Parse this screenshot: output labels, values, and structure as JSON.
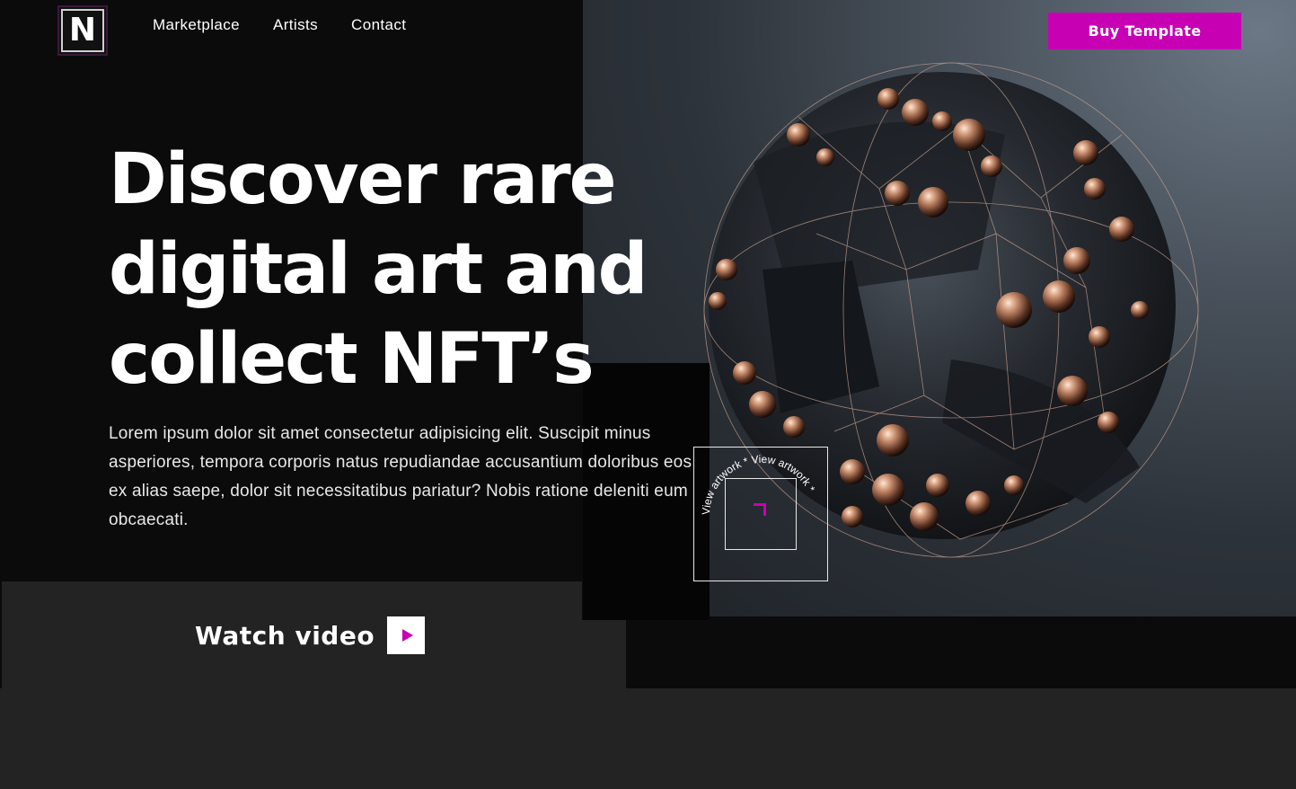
{
  "brand": {
    "logo_letter": "N"
  },
  "nav": {
    "items": [
      {
        "label": "Marketplace"
      },
      {
        "label": "Artists"
      },
      {
        "label": "Contact"
      }
    ]
  },
  "header": {
    "buy_label": "Buy Template"
  },
  "hero": {
    "headline_lines": [
      "Discover rare",
      "digital art and",
      "collect NFT’s"
    ],
    "lede": "Lorem ipsum dolor sit amet consectetur adipisicing elit. Suscipit minus asperiores, tempora corporis natus repudiandae accusantium doloribus eos ex alias saepe, dolor sit necessitatibus pariatur? Nobis ratione deleniti eum obcaecati.",
    "image_alt": "3D sphere with copper beads and wireframe",
    "watch_label": "Watch video",
    "badge_text": "View artwork * View artwork *"
  },
  "colors": {
    "accent": "#c800b4",
    "background": "#0b0b0c",
    "panel": "#232323"
  }
}
